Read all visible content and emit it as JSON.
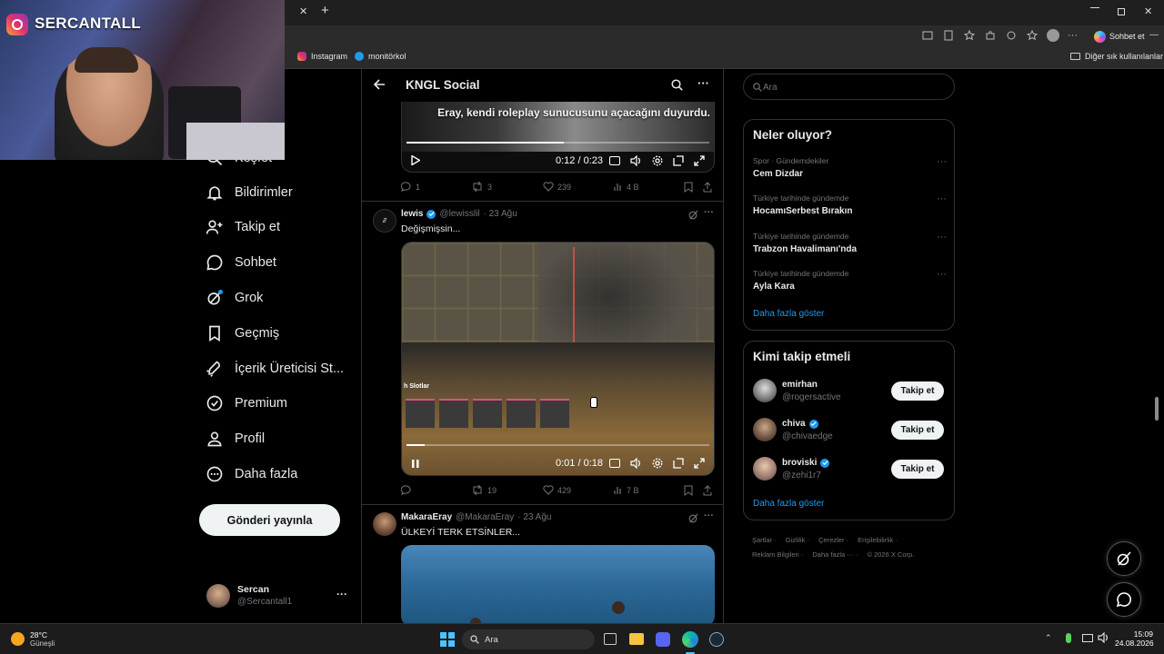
{
  "webcam": {
    "channel_name": "SERCANTALL"
  },
  "browser": {
    "close_tab": "✕",
    "new_tab": "+",
    "chat_label": "Sohbet et",
    "bookmarks": [
      {
        "label": "Instagram"
      },
      {
        "label": "monitörkol"
      }
    ],
    "other_bookmarks": "Diğer sık kullanılanlar"
  },
  "sidebar": {
    "items": [
      {
        "label": "Keşfet"
      },
      {
        "label": "Bildirimler"
      },
      {
        "label": "Takip et"
      },
      {
        "label": "Sohbet"
      },
      {
        "label": "Grok"
      },
      {
        "label": "Geçmiş"
      },
      {
        "label": "İçerik Üreticisi St..."
      },
      {
        "label": "Premium"
      },
      {
        "label": "Profil"
      },
      {
        "label": "Daha fazla"
      }
    ],
    "post_button": "Gönderi yayınla",
    "account": {
      "name": "Sercan",
      "handle": "@Sercantall1",
      "menu": "···"
    }
  },
  "header": {
    "title": "KNGL Social"
  },
  "posts": [
    {
      "video_caption": "Eray, kendi roleplay sunucusunu açacağını duyurdu.",
      "time": "0:12 / 0:23",
      "progress": 0.52,
      "stats": {
        "replies": "1",
        "reposts": "3",
        "likes": "239",
        "views": "4 B"
      }
    },
    {
      "name": "lewis",
      "verified": true,
      "handle": "@lewisslil",
      "date": "· 23 Ağu",
      "text": "Değişmişsin...",
      "time": "0:01 / 0:18",
      "progress": 0.06,
      "overlay_label": "h Slotlar",
      "stats": {
        "replies": "",
        "reposts": "19",
        "likes": "429",
        "views": "7 B"
      }
    },
    {
      "name": "MakaraEray",
      "verified": false,
      "handle": "@MakaraEray",
      "date": "· 23 Ağu",
      "text": "ÜLKEYİ TERK ETSİNLER..."
    }
  ],
  "search": {
    "placeholder": "Ara"
  },
  "trends": {
    "title": "Neler oluyor?",
    "items": [
      {
        "category": "Spor · Gündemdekiler",
        "title": "Cem Dizdar"
      },
      {
        "category": "Türkiye tarihinde gündemde",
        "title": "HocamıSerbest Bırakın"
      },
      {
        "category": "Türkiye tarihinde gündemde",
        "title": "Trabzon Havalimanı'nda"
      },
      {
        "category": "Türkiye tarihinde gündemde",
        "title": "Ayla Kara"
      }
    ],
    "more": "Daha fazla göster"
  },
  "who_to_follow": {
    "title": "Kimi takip etmeli",
    "users": [
      {
        "name": "emirhan",
        "handle": "@rogersactive",
        "verified": false
      },
      {
        "name": "chiva",
        "handle": "@chivaedge",
        "verified": true
      },
      {
        "name": "broviski",
        "handle": "@zehi1r7",
        "verified": true
      }
    ],
    "follow_label": "Takip et",
    "more": "Daha fazla göster"
  },
  "footer": {
    "links": [
      "Şartlar",
      "Gizlilik",
      "Çerezler",
      "Erişilebilirlik",
      "Reklam Bilgileri",
      "Daha fazla ···"
    ],
    "copyright": "© 2026 X Corp."
  },
  "taskbar": {
    "weather_temp": "28°C",
    "weather_desc": "Güneşli",
    "search": "Ara",
    "time": "15:09",
    "date": "24.08.2026"
  },
  "colors": {
    "accent": "#1d9bf0",
    "background": "#000000",
    "border": "#2f3336",
    "muted": "#71767b"
  }
}
